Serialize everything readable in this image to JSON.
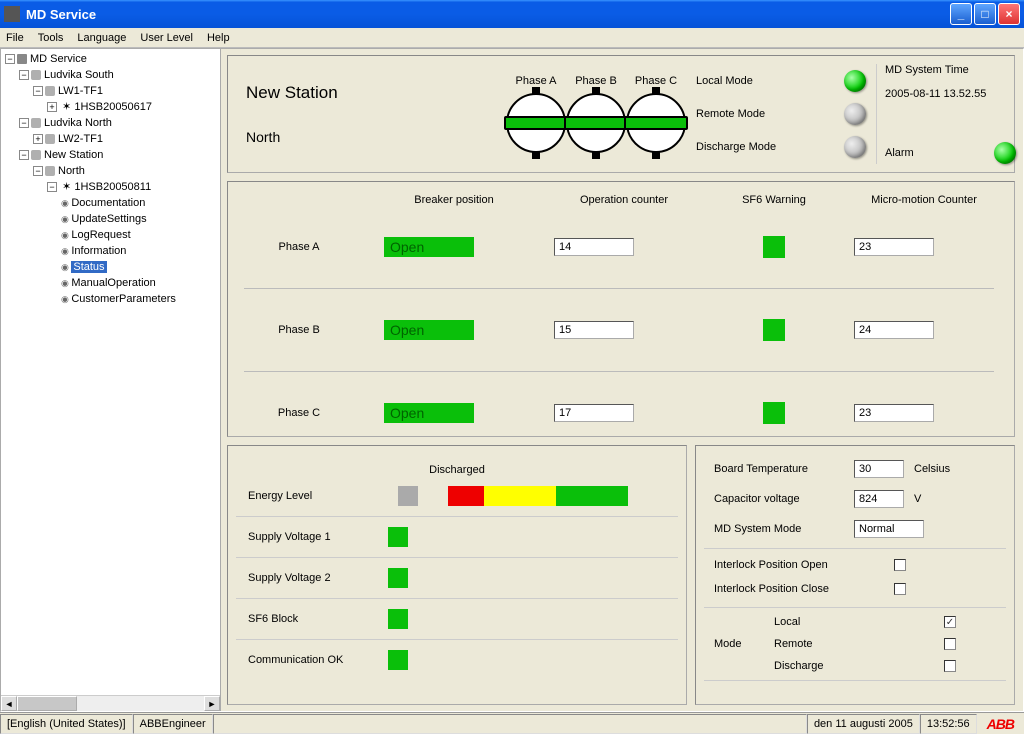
{
  "window": {
    "title": "MD Service"
  },
  "menu": {
    "file": "File",
    "tools": "Tools",
    "language": "Language",
    "userlevel": "User Level",
    "help": "Help"
  },
  "tree": {
    "root": "MD Service",
    "s1": "Ludvika South",
    "s1d": "LW1-TF1",
    "s1id": "1HSB20050617",
    "s2": "Ludvika North",
    "s2d": "LW2-TF1",
    "s3": "New Station",
    "s3d": "North",
    "s3id": "1HSB20050811",
    "l1": "Documentation",
    "l2": "UpdateSettings",
    "l3": "LogRequest",
    "l4": "Information",
    "l5": "Status",
    "l6": "ManualOperation",
    "l7": "CustomerParameters"
  },
  "header": {
    "station": "New Station",
    "sub": "North",
    "phaseA": "Phase A",
    "phaseB": "Phase B",
    "phaseC": "Phase C",
    "local": "Local Mode",
    "remote": "Remote Mode",
    "discharge": "Discharge Mode",
    "systime_label": "MD System Time",
    "systime": "2005-08-11 13.52.55",
    "alarm": "Alarm"
  },
  "table": {
    "h_breaker": "Breaker position",
    "h_op": "Operation counter",
    "h_sf6": "SF6 Warning",
    "h_mm": "Micro-motion Counter",
    "pA": "Phase A",
    "pB": "Phase B",
    "pC": "Phase C",
    "open": "Open",
    "opA": "14",
    "opB": "15",
    "opC": "17",
    "mmA": "23",
    "mmB": "24",
    "mmC": "23"
  },
  "left": {
    "discharged": "Discharged",
    "energy": "Energy Level",
    "sv1": "Supply Voltage 1",
    "sv2": "Supply Voltage 2",
    "sf6b": "SF6 Block",
    "comm": "Communication OK"
  },
  "right": {
    "bt": "Board Temperature",
    "bt_v": "30",
    "bt_u": "Celsius",
    "cv": "Capacitor voltage",
    "cv_v": "824",
    "cv_u": "V",
    "mm": "MD System Mode",
    "mm_v": "Normal",
    "ipo": "Interlock Position Open",
    "ipc": "Interlock Position Close",
    "mode": "Mode",
    "ml": "Local",
    "mr": "Remote",
    "md": "Discharge",
    "check": "✓"
  },
  "status": {
    "lang": "[English (United States)]",
    "user": "ABBEngineer",
    "date": "den 11 augusti 2005",
    "time": "13:52:56",
    "logo": "ABB"
  }
}
